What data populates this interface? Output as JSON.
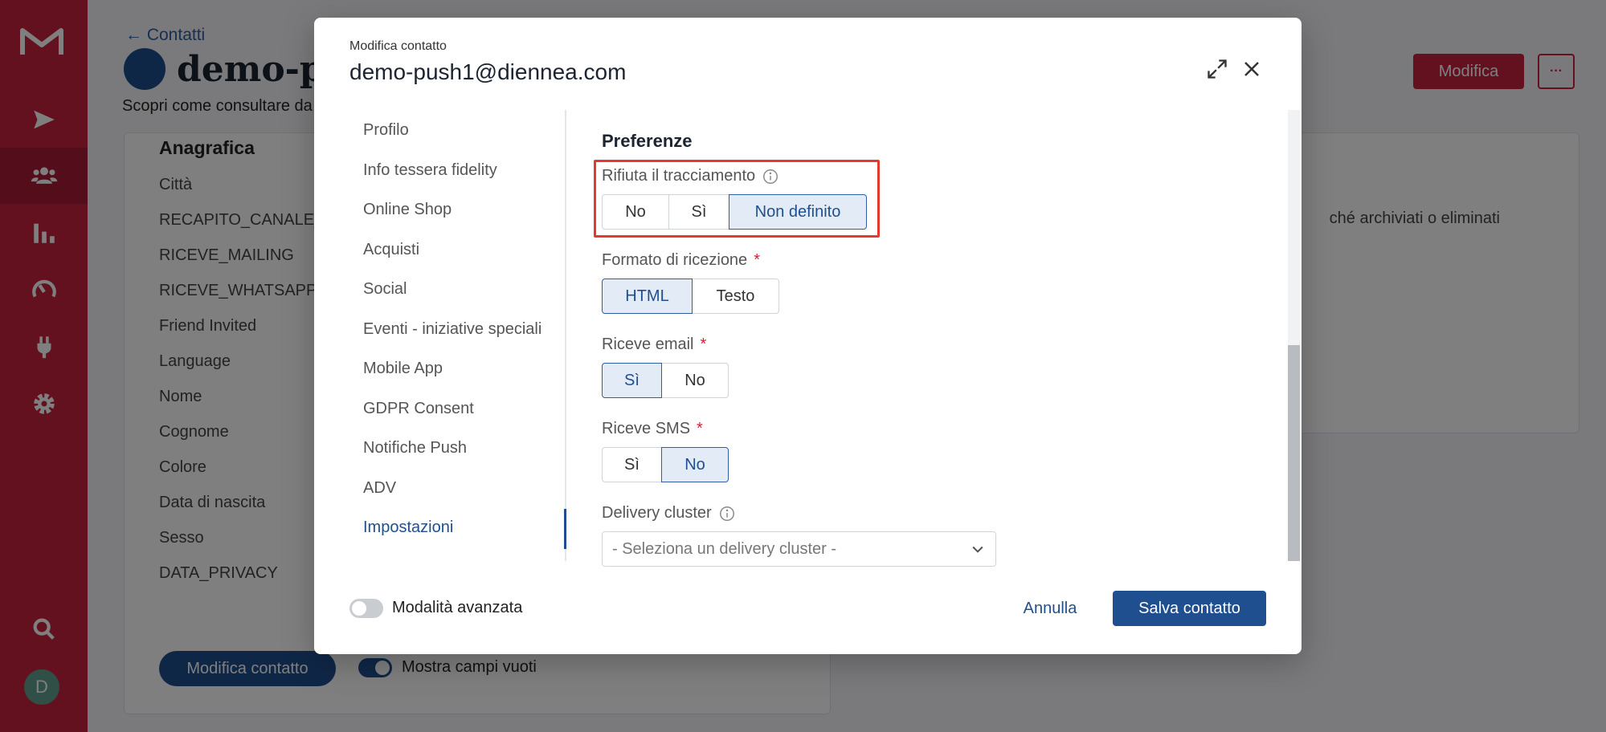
{
  "sidebar": {
    "avatar_initial": "D",
    "items": [
      {
        "icon": "send-icon"
      },
      {
        "icon": "users-icon",
        "active": true
      },
      {
        "icon": "bar-chart-icon"
      },
      {
        "icon": "gauge-icon"
      },
      {
        "icon": "plug-icon"
      },
      {
        "icon": "gear-icon"
      },
      {
        "icon": "search-icon"
      }
    ]
  },
  "page": {
    "back_link": "← Contatti",
    "title": "demo-pu",
    "subtitle": "Scopri come consultare da",
    "modify_button": "Modifica",
    "more_button": "···"
  },
  "card_left": {
    "heading": "Anagrafica",
    "fields": [
      "Città",
      "RECAPITO_CANALE_C",
      "RICEVE_MAILING",
      "RICEVE_WHATSAPP",
      "Friend Invited",
      "Language",
      "Nome",
      "Cognome",
      "Colore",
      "Data di nascita",
      "Sesso",
      "DATA_PRIVACY"
    ],
    "edit_button": "Modifica contatto",
    "show_empty_toggle_label": "Mostra campi vuoti"
  },
  "card_right": {
    "note": "ché archiviati o eliminati"
  },
  "modal": {
    "kicker": "Modifica contatto",
    "title": "demo-push1@diennea.com",
    "nav": [
      {
        "label": "Profilo"
      },
      {
        "label": "Info tessera fidelity"
      },
      {
        "label": "Online Shop"
      },
      {
        "label": "Acquisti"
      },
      {
        "label": "Social"
      },
      {
        "label": "Eventi - iniziative speciali"
      },
      {
        "label": "Mobile App"
      },
      {
        "label": "GDPR Consent"
      },
      {
        "label": "Notifiche Push"
      },
      {
        "label": "ADV"
      },
      {
        "label": "Impostazioni",
        "active": true
      }
    ],
    "section_title": "Preferenze",
    "fields": {
      "tracking": {
        "label": "Rifiuta il tracciamento",
        "options": [
          "No",
          "Sì",
          "Non definito"
        ],
        "selected": "Non definito"
      },
      "format": {
        "label": "Formato di ricezione",
        "required": "*",
        "options": [
          "HTML",
          "Testo"
        ],
        "selected": "HTML"
      },
      "email": {
        "label": "Riceve email",
        "required": "*",
        "options": [
          "Sì",
          "No"
        ],
        "selected": "Sì"
      },
      "sms": {
        "label": "Riceve SMS",
        "required": "*",
        "options": [
          "Sì",
          "No"
        ],
        "selected": "No"
      },
      "delivery": {
        "label": "Delivery cluster",
        "placeholder": "- Seleziona un delivery cluster -"
      }
    },
    "advanced_toggle_label": "Modalità avanzata",
    "cancel_button": "Annulla",
    "save_button": "Salva contatto"
  },
  "colors": {
    "brand": "#c8223f",
    "primary": "#1f4f8f",
    "highlight": "#e23b2e"
  }
}
